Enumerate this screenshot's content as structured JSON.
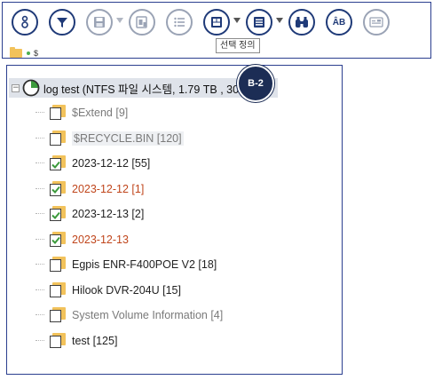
{
  "toolbar": {
    "tooltip": "선택 정의",
    "buttons": [
      {
        "icon": "info-icon"
      },
      {
        "icon": "filter-icon"
      },
      {
        "icon": "save-icon"
      },
      {
        "icon": "save-report-icon"
      },
      {
        "icon": "list-icon"
      },
      {
        "icon": "select-define-icon"
      },
      {
        "icon": "report-list-icon"
      },
      {
        "icon": "binoculars-icon"
      },
      {
        "icon": "text-encoding-icon",
        "label": "ÂB"
      },
      {
        "icon": "id-card-icon"
      }
    ]
  },
  "pathbar": {
    "path": "$"
  },
  "tree": {
    "root": {
      "label": "log test (NTFS 파일 시스템, 1.79 TB , 305 파일)"
    },
    "items": [
      {
        "label": "$Extend  [9]",
        "checked": false,
        "color": "gray"
      },
      {
        "label": "$RECYCLE.BIN  [120]",
        "checked": false,
        "color": "gray"
      },
      {
        "label": "2023-12-12  [55]",
        "checked": true,
        "color": "dark"
      },
      {
        "label": "2023-12-12  [1]",
        "checked": true,
        "color": "red"
      },
      {
        "label": "2023-12-13  [2]",
        "checked": true,
        "color": "dark"
      },
      {
        "label": "2023-12-13",
        "checked": true,
        "color": "red"
      },
      {
        "label": "Egpis ENR-F400POE V2  [18]",
        "checked": false,
        "color": "dark"
      },
      {
        "label": "Hilook DVR-204U  [15]",
        "checked": false,
        "color": "dark"
      },
      {
        "label": "System Volume Information  [4]",
        "checked": false,
        "color": "gray"
      },
      {
        "label": "test  [125]",
        "checked": false,
        "color": "dark"
      }
    ]
  },
  "badge": {
    "label": "B-2"
  },
  "colors": {
    "accent": "#1f3a78",
    "folder": "#f2c25b",
    "check": "#3c9a3c",
    "red_text": "#c0461c"
  }
}
